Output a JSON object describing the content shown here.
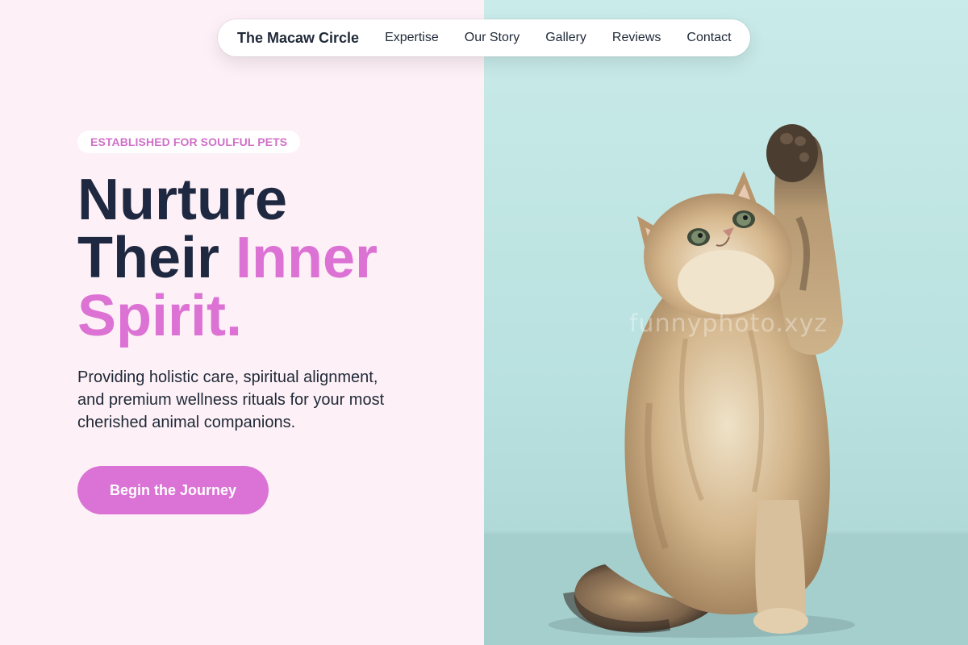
{
  "nav": {
    "brand": "The Macaw Circle",
    "links": [
      "Expertise",
      "Our Story",
      "Gallery",
      "Reviews",
      "Contact"
    ]
  },
  "hero": {
    "badge": "ESTABLISHED FOR SOULFUL PETS",
    "headline": {
      "line1": "Nurture",
      "line2_plain": "Their ",
      "line2_accent": "Inner",
      "line3_accent": "Spirit."
    },
    "description": "Providing holistic care, spiritual alignment, and premium wellness rituals for your most cherished animal companions.",
    "cta_label": "Begin the Journey"
  },
  "image": {
    "subject": "kitten-raising-paw",
    "watermark": "funnyphoto.xyz"
  },
  "colors": {
    "left_background": "#fdf0f6",
    "right_background": "#c3e6e4",
    "accent": "#dc72d4",
    "heading": "#1e2840",
    "text": "#1f2937"
  }
}
